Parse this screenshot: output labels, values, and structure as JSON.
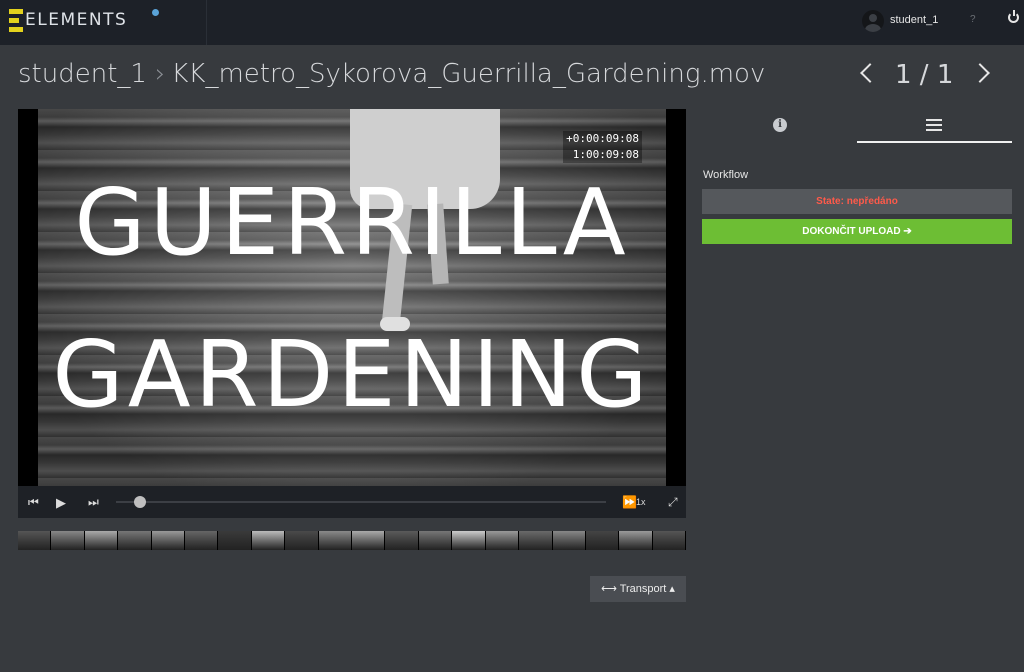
{
  "app": {
    "brand": "ELEMENTS"
  },
  "topbar": {
    "user_name": "student_1",
    "help_label": "?"
  },
  "title": {
    "parent": "student_1",
    "separator": "›",
    "file": "KK_metro_Sykorova_Guerrilla_Gardening.mov"
  },
  "pager": {
    "text": "1 / 1"
  },
  "player": {
    "frame_text_line1": "GUERRILLA",
    "frame_text_line2": "GARDENING",
    "timecode_relative": "+0:00:09:08",
    "timecode_absolute": "1:00:09:08",
    "speed": "1x",
    "progress": 0.05
  },
  "controls": {
    "prev": "⏮",
    "play": "▶",
    "next": "⏭",
    "ff": "⏩",
    "fullscreen": "⤢"
  },
  "transport": {
    "label": "⟷ Transport ▴"
  },
  "panel": {
    "tabs": [
      {
        "icon": "info-icon"
      },
      {
        "icon": "list-icon",
        "active": true
      }
    ],
    "workflow_label": "Workflow",
    "state_label": "State: nepředáno",
    "upload_label": "DOKONČIT UPLOAD ➔"
  },
  "colors": {
    "accent_green": "#6dbe34",
    "state_red": "#ff5a4a",
    "logo_yellow": "#e3d21d"
  }
}
